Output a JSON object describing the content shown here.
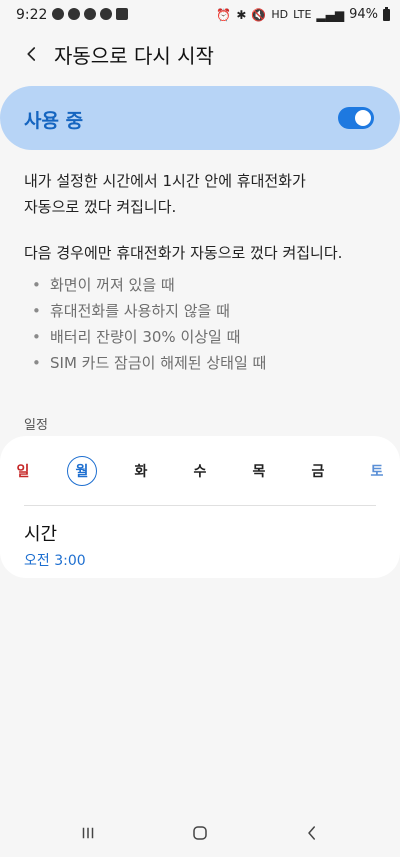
{
  "status_bar": {
    "time": "9:22",
    "network_label": "HD",
    "lte_label": "LTE",
    "battery_percent": "94%"
  },
  "header": {
    "title": "자동으로 다시 시작"
  },
  "master_switch": {
    "label": "사용 중",
    "enabled": true
  },
  "description": {
    "line1": "내가 설정한 시간에서 1시간 안에 휴대전화가",
    "line2": "자동으로 껐다 켜집니다."
  },
  "conditions": {
    "title": "다음 경우에만 휴대전화가 자동으로 껐다 켜집니다.",
    "bullet": "•",
    "items": [
      "화면이 꺼져 있을 때",
      "휴대전화를 사용하지 않을 때",
      "배터리 잔량이 30% 이상일 때",
      "SIM 카드 잠금이 해제된 상태일 때"
    ]
  },
  "schedule": {
    "section_label": "일정",
    "days": [
      "일",
      "월",
      "화",
      "수",
      "목",
      "금",
      "토"
    ],
    "selected_day": "월",
    "time_label": "시간",
    "time_value": "오전 3:00"
  },
  "colors": {
    "accent": "#1e6fd0",
    "switch_bg": "#b7d4f6",
    "sunday": "#c62828",
    "saturday": "#5a8fd6"
  }
}
